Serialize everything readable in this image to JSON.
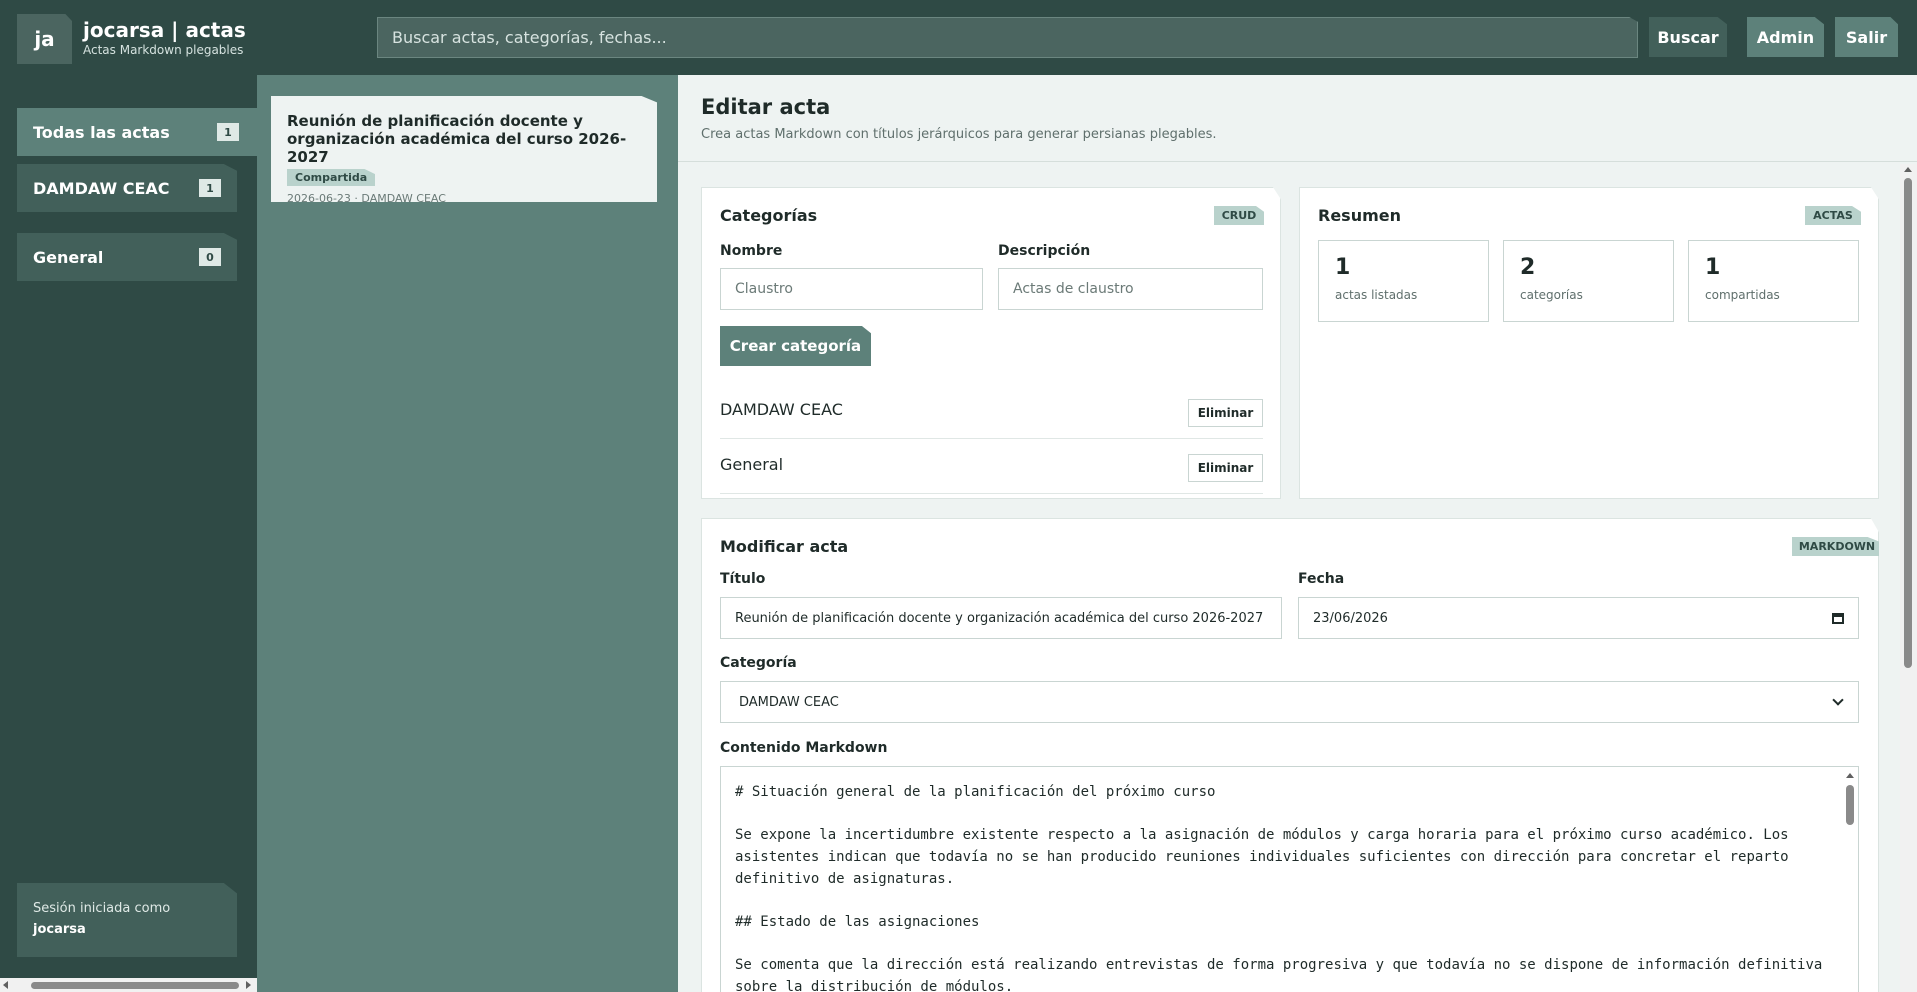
{
  "header": {
    "logo": "ja",
    "title": "jocarsa | actas",
    "subtitle": "Actas Markdown plegables",
    "search_placeholder": "Buscar actas, categorías, fechas...",
    "buttons": {
      "search": "Buscar",
      "admin": "Admin",
      "logout": "Salir"
    }
  },
  "sidebar": {
    "items": [
      {
        "label": "Todas las actas",
        "count": "1",
        "active": true
      },
      {
        "label": "DAMDAW CEAC",
        "count": "1",
        "active": false
      },
      {
        "label": "General",
        "count": "0",
        "active": false
      }
    ],
    "session": {
      "label": "Sesión iniciada como",
      "user": "jocarsa"
    }
  },
  "notes": [
    {
      "title": "Reunión de planificación docente y organización académica del curso 2026-2027",
      "badge": "Compartida",
      "meta": "2026-06-23 · DAMDAW CEAC"
    }
  ],
  "main": {
    "title": "Editar acta",
    "subtitle": "Crea actas Markdown con títulos jerárquicos para generar persianas plegables."
  },
  "categories_panel": {
    "title": "Categorías",
    "tag": "CRUD",
    "name_label": "Nombre",
    "name_placeholder": "Claustro",
    "desc_label": "Descripción",
    "desc_placeholder": "Actas de claustro",
    "create_button": "Crear categoría",
    "delete_label": "Eliminar",
    "items": [
      "DAMDAW CEAC",
      "General"
    ]
  },
  "summary_panel": {
    "title": "Resumen",
    "tag": "ACTAS",
    "stats": [
      {
        "value": "1",
        "label": "actas listadas"
      },
      {
        "value": "2",
        "label": "categorías"
      },
      {
        "value": "1",
        "label": "compartidas"
      }
    ]
  },
  "edit_panel": {
    "title": "Modificar acta",
    "tag": "MARKDOWN",
    "title_label": "Título",
    "title_value": "Reunión de planificación docente y organización académica del curso 2026-2027",
    "date_label": "Fecha",
    "date_value": "23/06/2026",
    "category_label": "Categoría",
    "category_value": "DAMDAW CEAC",
    "content_label": "Contenido Markdown",
    "content_lines": [
      "# Situación general de la planificación del próximo curso",
      "Se expone la incertidumbre existente respecto a la asignación de módulos y carga horaria para el próximo curso académico. Los asistentes indican que todavía no se han producido reuniones individuales suficientes con dirección para concretar el reparto definitivo de asignaturas.",
      "## Estado de las asignaciones",
      "Se comenta que la dirección está realizando entrevistas de forma progresiva y que todavía no se dispone de información definitiva sobre la distribución de módulos."
    ]
  },
  "colors": {
    "dark": "#2f4a45",
    "mid": "#42605a",
    "accent": "#5d817a",
    "light": "#eef3f2",
    "tag": "#b9d2cc"
  }
}
